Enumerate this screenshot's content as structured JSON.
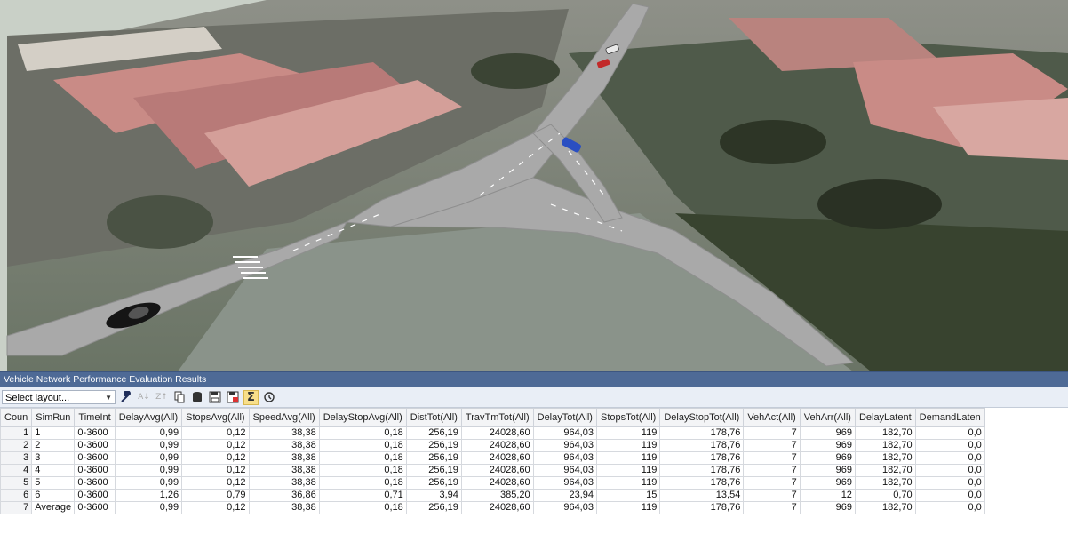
{
  "panel": {
    "title": "Vehicle Network Performance Evaluation Results",
    "layout_select": "Select layout..."
  },
  "toolbar_icons": [
    "wrench-icon",
    "sort-ascending-icon",
    "sort-descending-icon",
    "copy-icon",
    "database-icon",
    "save-icon",
    "save-as-icon",
    "sum-icon",
    "history-icon"
  ],
  "table": {
    "columns": [
      "Coun",
      "SimRun",
      "TimeInt",
      "DelayAvg(All)",
      "StopsAvg(All)",
      "SpeedAvg(All)",
      "DelayStopAvg(All)",
      "DistTot(All)",
      "TravTmTot(All)",
      "DelayTot(All)",
      "StopsTot(All)",
      "DelayStopTot(All)",
      "VehAct(All)",
      "VehArr(All)",
      "DelayLatent",
      "DemandLaten"
    ],
    "rows": [
      [
        "1",
        "1",
        "0-3600",
        "0,99",
        "0,12",
        "38,38",
        "0,18",
        "256,19",
        "24028,60",
        "964,03",
        "119",
        "178,76",
        "7",
        "969",
        "182,70",
        "0,0"
      ],
      [
        "2",
        "2",
        "0-3600",
        "0,99",
        "0,12",
        "38,38",
        "0,18",
        "256,19",
        "24028,60",
        "964,03",
        "119",
        "178,76",
        "7",
        "969",
        "182,70",
        "0,0"
      ],
      [
        "3",
        "3",
        "0-3600",
        "0,99",
        "0,12",
        "38,38",
        "0,18",
        "256,19",
        "24028,60",
        "964,03",
        "119",
        "178,76",
        "7",
        "969",
        "182,70",
        "0,0"
      ],
      [
        "4",
        "4",
        "0-3600",
        "0,99",
        "0,12",
        "38,38",
        "0,18",
        "256,19",
        "24028,60",
        "964,03",
        "119",
        "178,76",
        "7",
        "969",
        "182,70",
        "0,0"
      ],
      [
        "5",
        "5",
        "0-3600",
        "0,99",
        "0,12",
        "38,38",
        "0,18",
        "256,19",
        "24028,60",
        "964,03",
        "119",
        "178,76",
        "7",
        "969",
        "182,70",
        "0,0"
      ],
      [
        "6",
        "6",
        "0-3600",
        "1,26",
        "0,79",
        "36,86",
        "0,71",
        "3,94",
        "385,20",
        "23,94",
        "15",
        "13,54",
        "7",
        "12",
        "0,70",
        "0,0"
      ],
      [
        "7",
        "Average",
        "0-3600",
        "0,99",
        "0,12",
        "38,38",
        "0,18",
        "256,19",
        "24028,60",
        "964,03",
        "119",
        "178,76",
        "7",
        "969",
        "182,70",
        "0,0"
      ]
    ]
  },
  "colors": {
    "title_bar": "#4e6a96",
    "road": "#a9a9a9",
    "roof": "#c98b86"
  }
}
